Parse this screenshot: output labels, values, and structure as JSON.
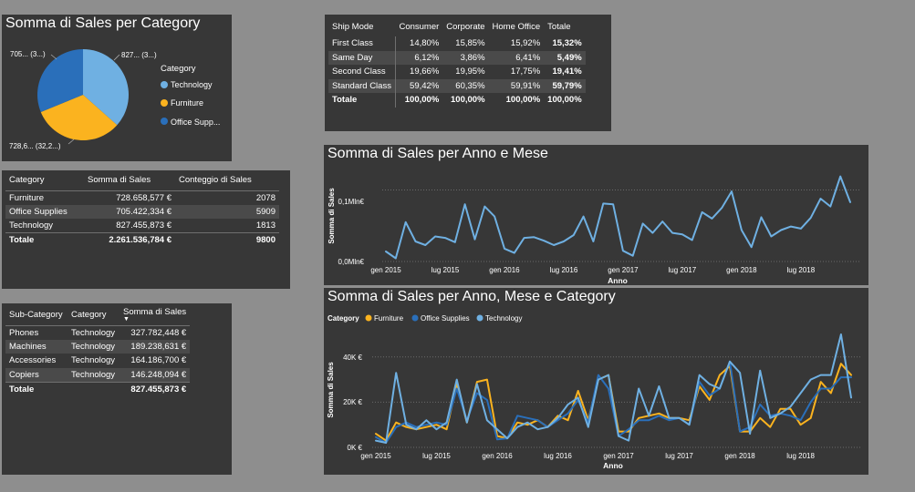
{
  "colors": {
    "background": "#8e8e8e",
    "panel": "#373737",
    "technology": "#6fb0e2",
    "furniture": "#fbb31f",
    "office_supplies": "#2a6fba"
  },
  "pie": {
    "title": "Somma di Sales per Category",
    "legend_title": "Category",
    "legend_items": [
      "Technology",
      "Furniture",
      "Office Supp..."
    ],
    "labels": [
      "827... (3...)",
      "728,6... (32,2...)",
      "705... (3...)"
    ],
    "chart_data": {
      "type": "pie",
      "categories": [
        "Technology",
        "Furniture",
        "Office Supplies"
      ],
      "values": [
        827455.873,
        728658.577,
        705422.334
      ]
    }
  },
  "ship_table": {
    "headers": [
      "Ship Mode",
      "Consumer",
      "Corporate",
      "Home Office",
      "Totale"
    ],
    "rows": [
      [
        "First Class",
        "14,80%",
        "15,85%",
        "15,92%",
        "15,32%"
      ],
      [
        "Same Day",
        "6,12%",
        "3,86%",
        "6,41%",
        "5,49%"
      ],
      [
        "Second Class",
        "19,66%",
        "19,95%",
        "17,75%",
        "19,41%"
      ],
      [
        "Standard Class",
        "59,42%",
        "60,35%",
        "59,91%",
        "59,79%"
      ]
    ],
    "total": [
      "Totale",
      "100,00%",
      "100,00%",
      "100,00%",
      "100,00%"
    ]
  },
  "cat_table": {
    "headers": [
      "Category",
      "Somma di Sales",
      "Conteggio di Sales"
    ],
    "rows": [
      [
        "Furniture",
        "728.658,577 €",
        "2078"
      ],
      [
        "Office Supplies",
        "705.422,334 €",
        "5909"
      ],
      [
        "Technology",
        "827.455,873 €",
        "1813"
      ]
    ],
    "total": [
      "Totale",
      "2.261.536,784 €",
      "9800"
    ]
  },
  "sub_table": {
    "headers": [
      "Sub-Category",
      "Category",
      "Somma di Sales"
    ],
    "rows": [
      [
        "Phones",
        "Technology",
        "327.782,448 €"
      ],
      [
        "Machines",
        "Technology",
        "189.238,631 €"
      ],
      [
        "Accessories",
        "Technology",
        "164.186,700 €"
      ],
      [
        "Copiers",
        "Technology",
        "146.248,094 €"
      ]
    ],
    "total": [
      "Totale",
      "",
      "827.455,873 €"
    ]
  },
  "line1": {
    "title": "Somma di Sales per Anno e Mese",
    "ylabel": "Somma di Sales",
    "xlabel": "Anno",
    "yticks": [
      "0,0Mln€",
      "0,1Mln€"
    ],
    "xticks": [
      "gen 2015",
      "lug 2015",
      "gen 2016",
      "lug 2016",
      "gen 2017",
      "lug 2017",
      "gen 2018",
      "lug 2018"
    ],
    "chart_data": {
      "type": "line",
      "x": [
        "gen 2015",
        "feb 2015",
        "mar 2015",
        "apr 2015",
        "mag 2015",
        "giu 2015",
        "lug 2015",
        "ago 2015",
        "set 2015",
        "ott 2015",
        "nov 2015",
        "dic 2015",
        "gen 2016",
        "feb 2016",
        "mar 2016",
        "apr 2016",
        "mag 2016",
        "giu 2016",
        "lug 2016",
        "ago 2016",
        "set 2016",
        "ott 2016",
        "nov 2016",
        "dic 2016",
        "gen 2017",
        "feb 2017",
        "mar 2017",
        "apr 2017",
        "mag 2017",
        "giu 2017",
        "lug 2017",
        "ago 2017",
        "set 2017",
        "ott 2017",
        "nov 2017",
        "dic 2017",
        "gen 2018",
        "feb 2018",
        "mar 2018",
        "apr 2018",
        "mag 2018",
        "giu 2018",
        "lug 2018",
        "ago 2018",
        "set 2018",
        "ott 2018",
        "nov 2018",
        "dic 2018"
      ],
      "series": [
        {
          "values": [
            14000,
            4500,
            55000,
            28000,
            23000,
            35000,
            33000,
            27000,
            80000,
            31000,
            77000,
            63000,
            18000,
            12000,
            33000,
            34000,
            29000,
            23000,
            28000,
            37000,
            63000,
            28000,
            81000,
            80000,
            15000,
            8000,
            53000,
            40000,
            56000,
            40000,
            38000,
            30000,
            69000,
            60000,
            75000,
            98000,
            44000,
            20000,
            62000,
            35000,
            44000,
            49000,
            46000,
            61000,
            88000,
            77000,
            119000,
            83000
          ]
        }
      ],
      "ylim": [
        0,
        130000
      ]
    }
  },
  "line2": {
    "title": "Somma di Sales per Anno, Mese e Category",
    "legend_title": "Category",
    "legend_items": [
      "Furniture",
      "Office Supplies",
      "Technology"
    ],
    "ylabel": "Somma di Sales",
    "xlabel": "Anno",
    "yticks": [
      "0K €",
      "20K €",
      "40K €"
    ],
    "xticks": [
      "gen 2015",
      "lug 2015",
      "gen 2016",
      "lug 2016",
      "gen 2017",
      "lug 2017",
      "gen 2018",
      "lug 2018"
    ],
    "chart_data": {
      "type": "line",
      "x": [
        "gen 2015",
        "feb 2015",
        "mar 2015",
        "apr 2015",
        "mag 2015",
        "giu 2015",
        "lug 2015",
        "ago 2015",
        "set 2015",
        "ott 2015",
        "nov 2015",
        "dic 2015",
        "gen 2016",
        "feb 2016",
        "mar 2016",
        "apr 2016",
        "mag 2016",
        "giu 2016",
        "lug 2016",
        "ago 2016",
        "set 2016",
        "ott 2016",
        "nov 2016",
        "dic 2016",
        "gen 2017",
        "feb 2017",
        "mar 2017",
        "apr 2017",
        "mag 2017",
        "giu 2017",
        "lug 2017",
        "ago 2017",
        "set 2017",
        "ott 2017",
        "nov 2017",
        "dic 2017",
        "gen 2018",
        "feb 2018",
        "mar 2018",
        "apr 2018",
        "mag 2018",
        "giu 2018",
        "lug 2018",
        "ago 2018",
        "set 2018",
        "ott 2018",
        "nov 2018",
        "dic 2018"
      ],
      "series": [
        {
          "name": "Furniture",
          "values": [
            6000,
            3000,
            11000,
            9000,
            8000,
            9000,
            10000,
            8000,
            28000,
            11000,
            29000,
            30000,
            5000,
            4000,
            11000,
            10000,
            12000,
            9000,
            14000,
            12000,
            25000,
            12000,
            30000,
            32000,
            7000,
            7000,
            13000,
            14000,
            15000,
            13000,
            13000,
            12000,
            27000,
            21000,
            32000,
            36000,
            7000,
            7000,
            13000,
            9000,
            17000,
            17000,
            10000,
            13000,
            29000,
            24000,
            37000,
            32000
          ]
        },
        {
          "name": "Office Supplies",
          "values": [
            4500,
            2000,
            9000,
            11000,
            9000,
            10000,
            11000,
            10000,
            26000,
            12000,
            24000,
            21000,
            3500,
            4000,
            14000,
            13000,
            12000,
            9000,
            12000,
            15000,
            21000,
            11000,
            32000,
            26000,
            5000,
            8000,
            12000,
            12000,
            14000,
            12000,
            13000,
            10000,
            29000,
            23000,
            26000,
            38000,
            7000,
            9000,
            19000,
            14000,
            15000,
            14000,
            12000,
            20000,
            26000,
            26000,
            31000,
            31000
          ]
        },
        {
          "name": "Technology",
          "values": [
            3000,
            2000,
            33000,
            10000,
            8000,
            12000,
            8000,
            11000,
            30000,
            11000,
            28000,
            12000,
            8000,
            4000,
            9000,
            11000,
            8000,
            9000,
            13000,
            19000,
            22000,
            9000,
            30000,
            32000,
            5000,
            3000,
            26000,
            14000,
            27000,
            13000,
            13000,
            10000,
            32000,
            28000,
            26000,
            38000,
            33000,
            6000,
            34000,
            13000,
            15000,
            18000,
            24000,
            30000,
            32000,
            32000,
            50000,
            22000
          ]
        }
      ],
      "ylim": [
        0,
        50000
      ]
    }
  }
}
